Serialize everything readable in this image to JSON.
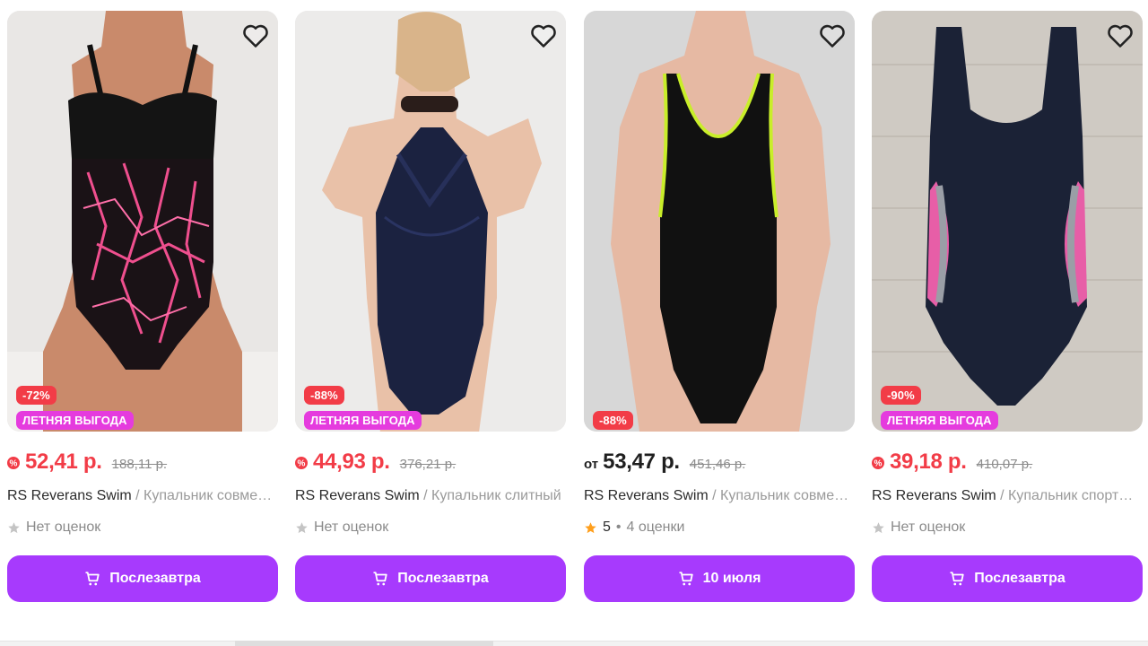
{
  "products": [
    {
      "discount": "-72%",
      "promo": "ЛЕТНЯЯ ВЫГОДА",
      "price_prefix": "",
      "price": "52,41 р.",
      "old_price": "188,11 р.",
      "brand": "RS Reverans Swim",
      "name": " / Купальник совместный",
      "rating_text": "Нет оценок",
      "score": "",
      "reviews": "",
      "button_label": "Послезавтра",
      "image_icon": "swimsuit-pink-pattern",
      "price_icon": "price-badge-icon"
    },
    {
      "discount": "-88%",
      "promo": "ЛЕТНЯЯ ВЫГОДА",
      "price_prefix": "",
      "price": "44,93 р.",
      "old_price": "376,21 р.",
      "brand": "RS Reverans Swim",
      "name": " / Купальник слитный",
      "rating_text": "Нет оценок",
      "score": "",
      "reviews": "",
      "button_label": "Послезавтра",
      "image_icon": "swimsuit-navy-halter",
      "price_icon": "price-badge-icon"
    },
    {
      "discount": "-88%",
      "promo": "",
      "price_prefix": "от",
      "price": "53,47 р.",
      "old_price": "451,46 р.",
      "brand": "RS Reverans Swim",
      "name": " / Купальник совместный",
      "rating_text": "",
      "score": "5",
      "reviews": "4 оценки",
      "button_label": "10 июля",
      "image_icon": "swimsuit-black-sport",
      "price_icon": ""
    },
    {
      "discount": "-90%",
      "promo": "ЛЕТНЯЯ ВЫГОДА",
      "price_prefix": "",
      "price": "39,18 р.",
      "old_price": "410,07 р.",
      "brand": "RS Reverans Swim",
      "name": " / Купальник спортивный",
      "rating_text": "Нет оценок",
      "score": "",
      "reviews": "",
      "button_label": "Послезавтра",
      "image_icon": "swimsuit-navy-pink",
      "price_icon": "price-badge-icon"
    }
  ],
  "colors": {
    "accent": "#a73afd",
    "price_red": "#f23c47",
    "promo_pink": "#e53bde",
    "star_orange": "#ff9f1c",
    "star_grey": "#c4c4c4"
  }
}
